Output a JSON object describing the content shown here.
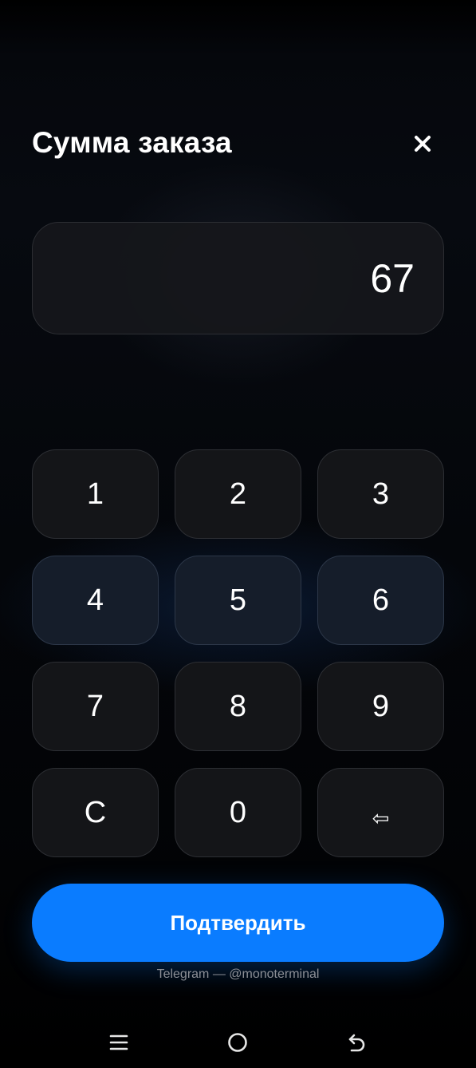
{
  "header": {
    "title": "Сумма заказа",
    "close_icon": "close-icon"
  },
  "display": {
    "value": "67"
  },
  "keypad": {
    "keys": [
      "1",
      "2",
      "3",
      "4",
      "5",
      "6",
      "7",
      "8",
      "9",
      "C",
      "0",
      "⇦"
    ]
  },
  "confirm": {
    "label": "Подтвердить"
  },
  "footer": {
    "text": "Telegram — @monoterminal"
  },
  "navbar": {
    "icons": [
      "menu-icon",
      "home-icon",
      "back-icon"
    ]
  },
  "colors": {
    "accent": "#0a7cff",
    "background": "#000000",
    "key_background": "#141518",
    "footer_text": "#8c8f96"
  }
}
